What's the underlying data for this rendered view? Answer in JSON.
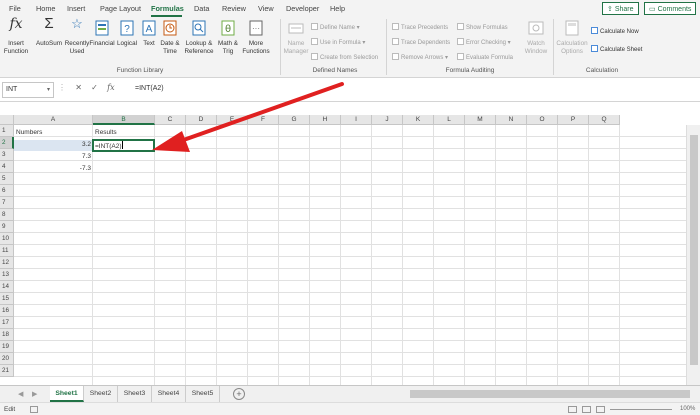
{
  "menu": {
    "tabs": [
      "File",
      "Home",
      "Insert",
      "Page Layout",
      "Formulas",
      "Data",
      "Review",
      "View",
      "Developer",
      "Help"
    ],
    "active": "Formulas",
    "share": "Share",
    "comments": "Comments"
  },
  "ribbon": {
    "insert_function": "Insert Function",
    "autosum": "AutoSum",
    "recently_used": "Recently Used",
    "financial": "Financial",
    "logical": "Logical",
    "text": "Text",
    "date_time": "Date & Time",
    "lookup_reference": "Lookup & Reference",
    "math_trig": "Math & Trig",
    "more_functions": "More Functions",
    "function_library": "Function Library",
    "name_manager": "Name Manager",
    "define_name": "Define Name",
    "use_in_formula": "Use in Formula",
    "create_from_selection": "Create from Selection",
    "defined_names": "Defined Names",
    "trace_precedents": "Trace Precedents",
    "trace_dependents": "Trace Dependents",
    "remove_arrows": "Remove Arrows",
    "show_formulas": "Show Formulas",
    "error_checking": "Error Checking",
    "evaluate_formula": "Evaluate Formula",
    "formula_auditing": "Formula Auditing",
    "watch_window": "Watch Window",
    "calculation_options": "Calculation Options",
    "calculate_now": "Calculate Now",
    "calculate_sheet": "Calculate Sheet",
    "calculation": "Calculation"
  },
  "formula_bar": {
    "name_box": "INT",
    "formula": "=INT(A2)"
  },
  "grid": {
    "columns": [
      "A",
      "B",
      "C",
      "D",
      "E",
      "F",
      "G",
      "H",
      "I",
      "J",
      "K",
      "L",
      "M",
      "N",
      "O",
      "P",
      "Q"
    ],
    "rows": [
      "1",
      "2",
      "3",
      "4",
      "5",
      "6",
      "7",
      "8",
      "9",
      "10",
      "11",
      "12",
      "13",
      "14",
      "15",
      "16",
      "17",
      "18",
      "19",
      "20",
      "21"
    ],
    "cells": {
      "A1": "Numbers",
      "B1": "Results",
      "A2": "3.2",
      "B2": "=INT(A2)",
      "A3": "7.3",
      "A4": "-7.3"
    }
  },
  "sheets": [
    "Sheet1",
    "Sheet2",
    "Sheet3",
    "Sheet4",
    "Sheet5"
  ],
  "active_sheet": "Sheet1",
  "status": {
    "mode": "Edit",
    "zoom": "100%"
  },
  "colors": {
    "accent": "#217346",
    "arrow": "#e02020"
  }
}
